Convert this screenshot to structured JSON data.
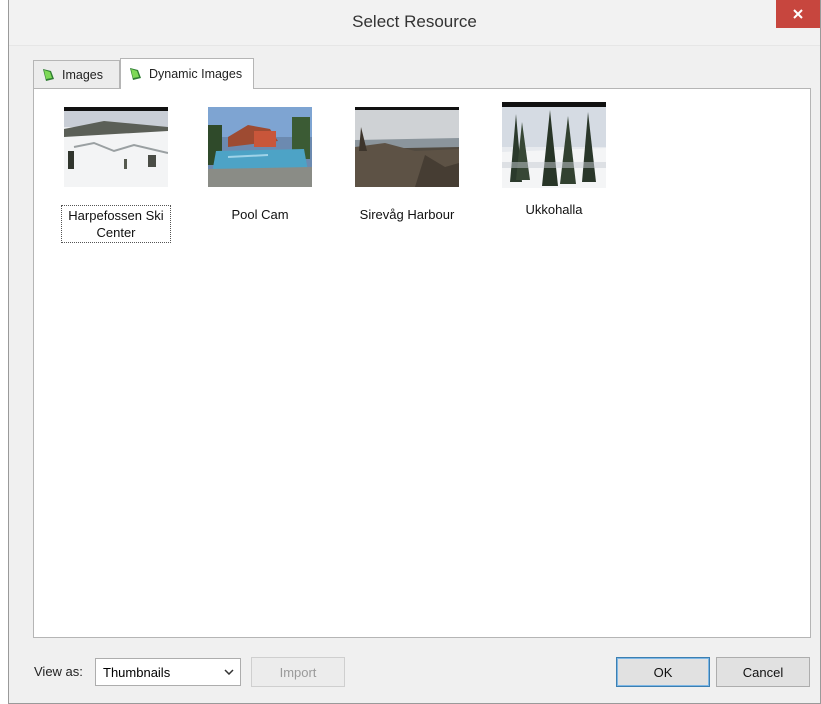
{
  "window": {
    "title": "Select Resource"
  },
  "tabs": [
    {
      "label": "Images",
      "icon": "resource-icon",
      "active": false
    },
    {
      "label": "Dynamic Images",
      "icon": "resource-icon",
      "active": true
    }
  ],
  "items": [
    {
      "label": "Harpefossen Ski Center",
      "focused": true
    },
    {
      "label": "Pool Cam",
      "focused": false
    },
    {
      "label": "Sirevåg Harbour",
      "focused": false
    },
    {
      "label": "Ukkohalla",
      "focused": false
    }
  ],
  "footer": {
    "view_as_label": "View as:",
    "view_as_value": "Thumbnails",
    "import_label": "Import",
    "ok_label": "OK",
    "cancel_label": "Cancel"
  },
  "colors": {
    "close_button": "#c7463e",
    "accent": "#3c7fb1"
  }
}
